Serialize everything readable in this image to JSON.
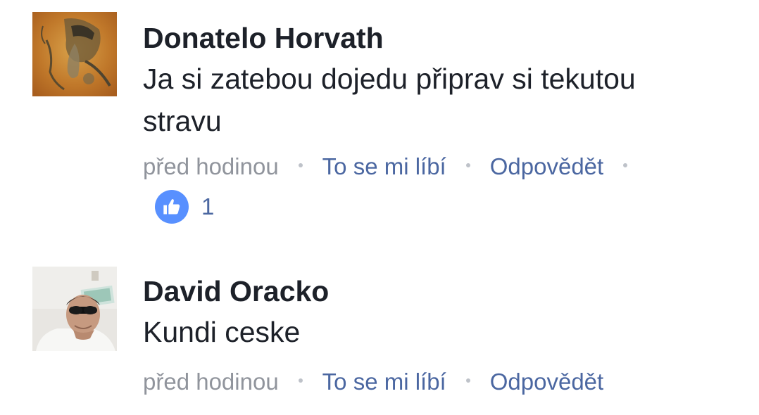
{
  "comments": [
    {
      "author": "Donatelo Horvath",
      "text_line1": "Ja si zatebou dojedu připrav si tekutou",
      "text_line2": "stravu",
      "time": "před hodinou",
      "like_label": "To se mi líbí",
      "reply_label": "Odpovědět",
      "reaction_icon": "thumbs-up-icon",
      "reaction_count": "1",
      "avatar_icon": "avatar-photo-tattoo"
    },
    {
      "author": "David Oracko",
      "text_line1": "Kundi ceske",
      "time": "před hodinou",
      "like_label": "To se mi líbí",
      "reply_label": "Odpovědět",
      "avatar_icon": "avatar-photo-man-sunglasses"
    }
  ],
  "colors": {
    "author": "#1d2129",
    "meta": "#90949c",
    "action_link": "#4b67a1",
    "like_badge": "#5890ff"
  }
}
